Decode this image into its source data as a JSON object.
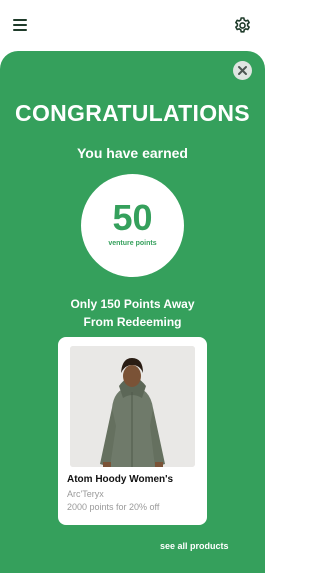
{
  "header": {
    "menu_icon": "hamburger-menu-icon",
    "settings_icon": "gear-icon"
  },
  "reward": {
    "close_icon": "close-icon",
    "title": "CONGRATULATIONS",
    "subtitle": "You have earned",
    "points_value": "50",
    "points_unit": "venture points",
    "away_line_1": "Only 150 Points Away",
    "away_line_2": "From Redeeming"
  },
  "product": {
    "name": "Atom Hoody Women's",
    "brand": "Arc'Teryx",
    "offer": "2000 points for 20% off"
  },
  "footer": {
    "see_all_label": "see all products"
  },
  "colors": {
    "accent": "#35a05c",
    "header_icon": "#1f3b2a",
    "close_bg": "#dfe5e1"
  }
}
